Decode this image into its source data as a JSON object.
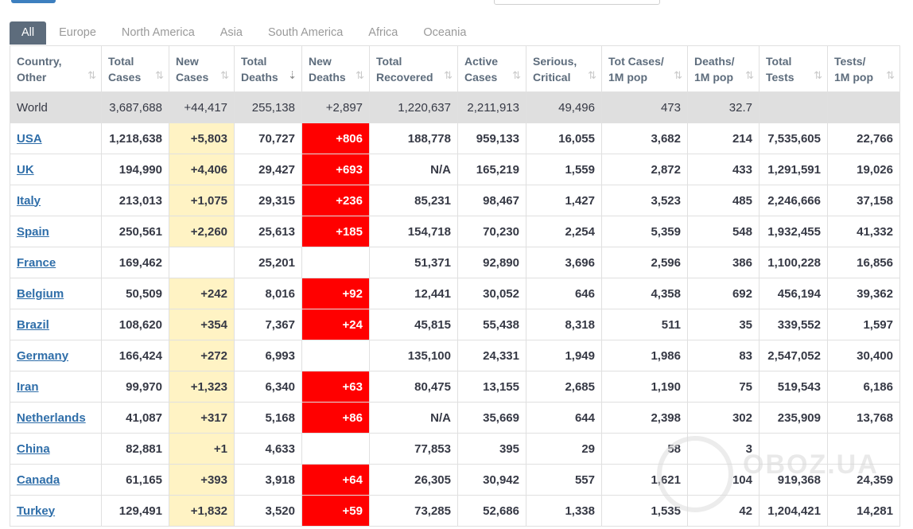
{
  "tabs": [
    "All",
    "Europe",
    "North America",
    "Asia",
    "South America",
    "Africa",
    "Oceania"
  ],
  "active_tab": "All",
  "columns": [
    {
      "l1": "Country,",
      "l2": "Other"
    },
    {
      "l1": "Total",
      "l2": "Cases"
    },
    {
      "l1": "New",
      "l2": "Cases"
    },
    {
      "l1": "Total",
      "l2": "Deaths"
    },
    {
      "l1": "New",
      "l2": "Deaths"
    },
    {
      "l1": "Total",
      "l2": "Recovered"
    },
    {
      "l1": "Active",
      "l2": "Cases"
    },
    {
      "l1": "Serious,",
      "l2": "Critical"
    },
    {
      "l1": "Tot Cases/",
      "l2": "1M pop"
    },
    {
      "l1": "Deaths/",
      "l2": "1M pop"
    },
    {
      "l1": "Total",
      "l2": "Tests"
    },
    {
      "l1": "Tests/",
      "l2": "1M pop"
    }
  ],
  "world": [
    "World",
    "3,687,688",
    "+44,417",
    "255,138",
    "+2,897",
    "1,220,637",
    "2,211,913",
    "49,496",
    "473",
    "32.7",
    "",
    ""
  ],
  "rows": [
    [
      "USA",
      "1,218,638",
      "+5,803",
      "70,727",
      "+806",
      "188,778",
      "959,133",
      "16,055",
      "3,682",
      "214",
      "7,535,605",
      "22,766"
    ],
    [
      "UK",
      "194,990",
      "+4,406",
      "29,427",
      "+693",
      "N/A",
      "165,219",
      "1,559",
      "2,872",
      "433",
      "1,291,591",
      "19,026"
    ],
    [
      "Italy",
      "213,013",
      "+1,075",
      "29,315",
      "+236",
      "85,231",
      "98,467",
      "1,427",
      "3,523",
      "485",
      "2,246,666",
      "37,158"
    ],
    [
      "Spain",
      "250,561",
      "+2,260",
      "25,613",
      "+185",
      "154,718",
      "70,230",
      "2,254",
      "5,359",
      "548",
      "1,932,455",
      "41,332"
    ],
    [
      "France",
      "169,462",
      "",
      "25,201",
      "",
      "51,371",
      "92,890",
      "3,696",
      "2,596",
      "386",
      "1,100,228",
      "16,856"
    ],
    [
      "Belgium",
      "50,509",
      "+242",
      "8,016",
      "+92",
      "12,441",
      "30,052",
      "646",
      "4,358",
      "692",
      "456,194",
      "39,362"
    ],
    [
      "Brazil",
      "108,620",
      "+354",
      "7,367",
      "+24",
      "45,815",
      "55,438",
      "8,318",
      "511",
      "35",
      "339,552",
      "1,597"
    ],
    [
      "Germany",
      "166,424",
      "+272",
      "6,993",
      "",
      "135,100",
      "24,331",
      "1,949",
      "1,986",
      "83",
      "2,547,052",
      "30,400"
    ],
    [
      "Iran",
      "99,970",
      "+1,323",
      "6,340",
      "+63",
      "80,475",
      "13,155",
      "2,685",
      "1,190",
      "75",
      "519,543",
      "6,186"
    ],
    [
      "Netherlands",
      "41,087",
      "+317",
      "5,168",
      "+86",
      "N/A",
      "35,669",
      "644",
      "2,398",
      "302",
      "235,909",
      "13,768"
    ],
    [
      "China",
      "82,881",
      "+1",
      "4,633",
      "",
      "77,853",
      "395",
      "29",
      "58",
      "3",
      "",
      ""
    ],
    [
      "Canada",
      "61,165",
      "+393",
      "3,918",
      "+64",
      "26,305",
      "30,942",
      "557",
      "1,621",
      "104",
      "919,368",
      "24,359"
    ],
    [
      "Turkey",
      "129,491",
      "+1,832",
      "3,520",
      "+59",
      "73,285",
      "52,686",
      "1,338",
      "1,535",
      "42",
      "1,204,421",
      "14,281"
    ]
  ],
  "watermark": "OBOZ.UA",
  "colors": {
    "new_cases_bg": "#fff3c4",
    "new_deaths_bg": "#ff0000",
    "world_bg": "#dfdfdf",
    "link": "#2f6ea9",
    "tab_active": "#5d6c7c"
  }
}
